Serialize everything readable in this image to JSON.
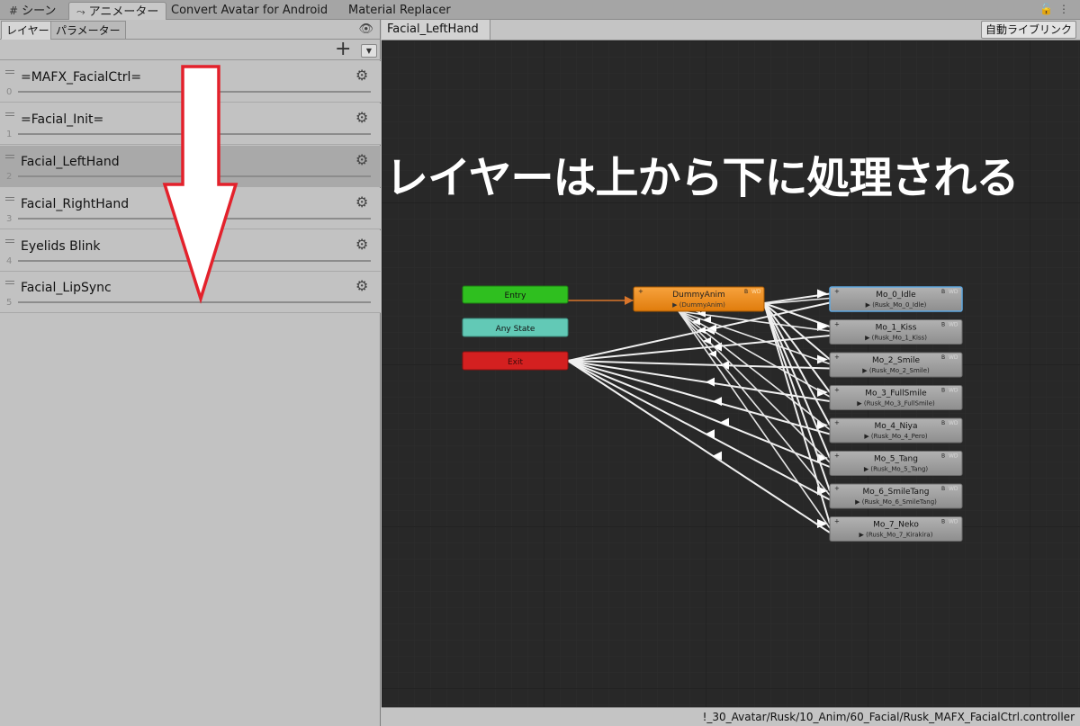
{
  "window_tabs": [
    {
      "icon": "grid-icon",
      "label": "シーン"
    },
    {
      "icon": "animator-icon",
      "label": "アニメーター"
    },
    {
      "label": "Convert Avatar for Android"
    },
    {
      "label": "Material Replacer"
    }
  ],
  "left_panel": {
    "tabs": [
      "レイヤー",
      "パラメーター"
    ],
    "layers": [
      {
        "name": "=MAFX_FacialCtrl=",
        "index": "0"
      },
      {
        "name": "=Facial_Init=",
        "index": "1"
      },
      {
        "name": "Facial_LeftHand",
        "index": "2",
        "selected": true
      },
      {
        "name": "Facial_RightHand",
        "index": "3"
      },
      {
        "name": "Eyelids Blink",
        "index": "4"
      },
      {
        "name": "Facial_LipSync",
        "index": "5"
      }
    ]
  },
  "right_panel": {
    "breadcrumb": "Facial_LeftHand",
    "auto_live_link": "自動ライブリンク",
    "controller_path": "!_30_Avatar/Rusk/10_Anim/60_Facial/Rusk_MAFX_FacialCtrl.controller"
  },
  "graph": {
    "entry": "Entry",
    "any_state": "Any State",
    "exit": "Exit",
    "dummy": {
      "name": "DummyAnim",
      "motion": "(DummyAnim)"
    },
    "states": [
      {
        "name": "Mo_0_Idle",
        "motion": "(Rusk_Mo_0_Idle)"
      },
      {
        "name": "Mo_1_Kiss",
        "motion": "(Rusk_Mo_1_Kiss)"
      },
      {
        "name": "Mo_2_Smile",
        "motion": "(Rusk_Mo_2_Smile)"
      },
      {
        "name": "Mo_3_FullSmile",
        "motion": "(Rusk_Mo_3_FullSmile)"
      },
      {
        "name": "Mo_4_Niya",
        "motion": "(Rusk_Mo_4_Pero)"
      },
      {
        "name": "Mo_5_Tang",
        "motion": "(Rusk_Mo_5_Tang)"
      },
      {
        "name": "Mo_6_SmileTang",
        "motion": "(Rusk_Mo_6_SmileTang)"
      },
      {
        "name": "Mo_7_Neko",
        "motion": "(Rusk_Mo_7_Kirakira)"
      }
    ],
    "badge_b": "B",
    "badge_wd": "WD",
    "colors": {
      "entry": "#2fbf1f",
      "any_state": "#62c9b6",
      "exit": "#d42020",
      "dummy": "#f08a15",
      "state": "#9a9a9a",
      "background": "#282828"
    }
  },
  "annotation": {
    "caption": "レイヤーは上から下に処理される",
    "arrow_color": "#e3212b"
  }
}
